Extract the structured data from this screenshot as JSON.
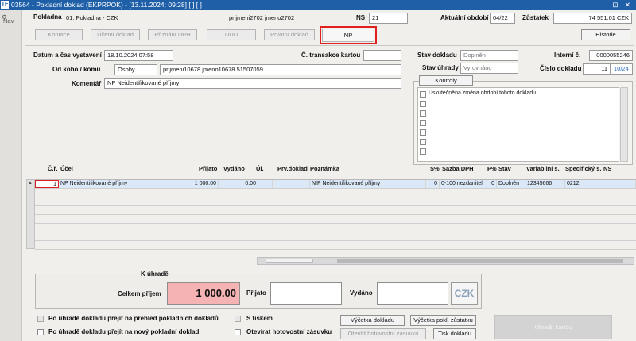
{
  "window": {
    "title": "03564 - Pokladní doklad (EKPRPOK) - [13.11.2024; 09:28] [ ] [ ]",
    "logo": "TF",
    "controls": "⊡ ✕"
  },
  "leftnav": {
    "label": "Nav"
  },
  "header": {
    "pokladna_label": "Pokladna",
    "pokladna_value": "01. Pokladna - CZK",
    "user_value": "prijmeni2702 jmeno2702",
    "ns_label": "NS",
    "ns_value": "21",
    "obdobi_label": "Aktuální období",
    "obdobi_value": "04/22",
    "zustatek_label": "Zůstatek",
    "zustatek_value": "74 551.01 CZK"
  },
  "toolbar": {
    "kontace": "Kontace",
    "ucetni_doklad": "Účetní doklad",
    "priznani_dph": "Přiznání DPH",
    "udd": "ÚDD",
    "prvotni_doklad": "Prvotní doklad",
    "np": "NP",
    "historie": "Historie"
  },
  "form": {
    "datum_label": "Datum a čas vystavení",
    "datum_value": "18.10.2024 07:58",
    "transakce_label": "Č. transakce kartou",
    "transakce_value": "",
    "od_koho_label": "Od koho / komu",
    "osoba_type": "Osoby",
    "osoba_value": "prijmeni10678 jmeno10678 51507059",
    "komentar_label": "Komentář",
    "komentar_value": "NP Neidentifikované příjmy",
    "stav_dokladu_label": "Stav dokladu",
    "stav_dokladu_value": "Doplněn",
    "stav_uhrady_label": "Stav úhrady",
    "stav_uhrady_value": "Vyrovnáno",
    "interni_label": "Interní č.",
    "interni_value": "0000055246",
    "cislo_label": "Číslo dokladu",
    "cislo_value": "11",
    "cislo_suffix": "10/24",
    "kontroly_tab": "Kontroly",
    "kontroly_item": "Uskutečněna změna období tohoto dokladu."
  },
  "grid": {
    "headers": {
      "cr": "Č.ř.",
      "ucel": "Účel",
      "prijato": "Přijato",
      "vydano": "Vydáno",
      "ul": "Úl.",
      "prv": "Prv.doklad",
      "poznamka": "Poznámka",
      "s_pct": "S%",
      "sazba": "Sazba DPH",
      "p_pct": "P%",
      "stav": "Stav",
      "vs": "Variabilní s.",
      "ss": "Specifický s.",
      "ns": "NS"
    },
    "row": {
      "cr": "1",
      "ucel": "NP Neidentifikované příjmy",
      "prijato": "1 000.00",
      "vydano": "0.00",
      "poznamka": "NIP Neidentifikované příjmy",
      "s": "0",
      "sazba": "0-100 nezdanitel",
      "p": "0",
      "stav": "Doplněn",
      "vs": "12345666",
      "ss": "0212"
    }
  },
  "payment": {
    "title": "K úhradě",
    "celkem_label": "Celkem příjem",
    "celkem_value": "1 000.00",
    "prijato_label": "Přijato",
    "prijato_value": "",
    "vydano_label": "Vydáno",
    "vydano_value": "",
    "currency": "CZK"
  },
  "footer": {
    "opt1": "Po úhradě dokladu přejít na přehled pokladních dokladů",
    "opt2": "Po úhradě dokladu přejít na nový pokladní doklad",
    "tisk_label": "S tiskem",
    "zasuvka_label": "Otevírat hotovostní zásuvku",
    "vycetka_doklad": "Výčetka dokladu",
    "vycetka_zustatku": "Výčetka pokl. zůstatku",
    "otevrit_zasuvku": "Otevřít hotovostní zásuvku",
    "tisk_dokladu": "Tisk dokladu",
    "uhradit": "Uhradit kartou"
  }
}
